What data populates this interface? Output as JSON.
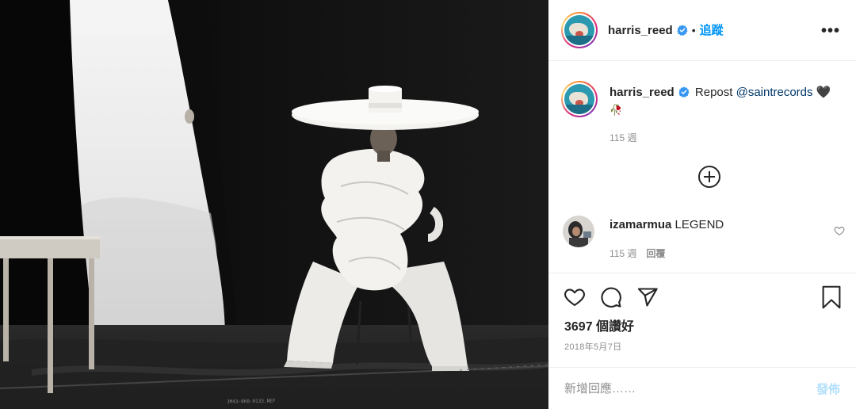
{
  "post": {
    "author": "harris_reed",
    "follow_label": "追蹤",
    "dot": "•",
    "more_label": "•••"
  },
  "caption": {
    "username": "harris_reed",
    "text_prefix": "Repost ",
    "mention": "@saintrecords",
    "emoji_heart": "🖤",
    "emoji_rose": "🥀",
    "age": "115 週"
  },
  "comments": [
    {
      "username": "izamarmua",
      "text": "LEGEND",
      "age": "115 週",
      "reply_label": "回覆"
    }
  ],
  "engagement": {
    "likes": "3697 個讚好",
    "date": "2018年5月7日"
  },
  "composer": {
    "placeholder": "新增回應……",
    "post_label": "發佈"
  },
  "icons": {
    "verified": "verified-badge-icon",
    "like": "heart-icon",
    "comment": "comment-bubble-icon",
    "share": "paper-plane-icon",
    "save": "bookmark-icon",
    "load_more": "plus-circle-icon",
    "comment_like": "heart-outline-small-icon",
    "options": "more-options-icon"
  },
  "colors": {
    "link_blue": "#0095f6",
    "mention_blue": "#00376b",
    "verified_blue": "#3897f0",
    "muted": "#8e8e8e",
    "post_disabled": "#b2dffc"
  },
  "photo": {
    "film_code": "JM43-060-0133.NEF"
  }
}
